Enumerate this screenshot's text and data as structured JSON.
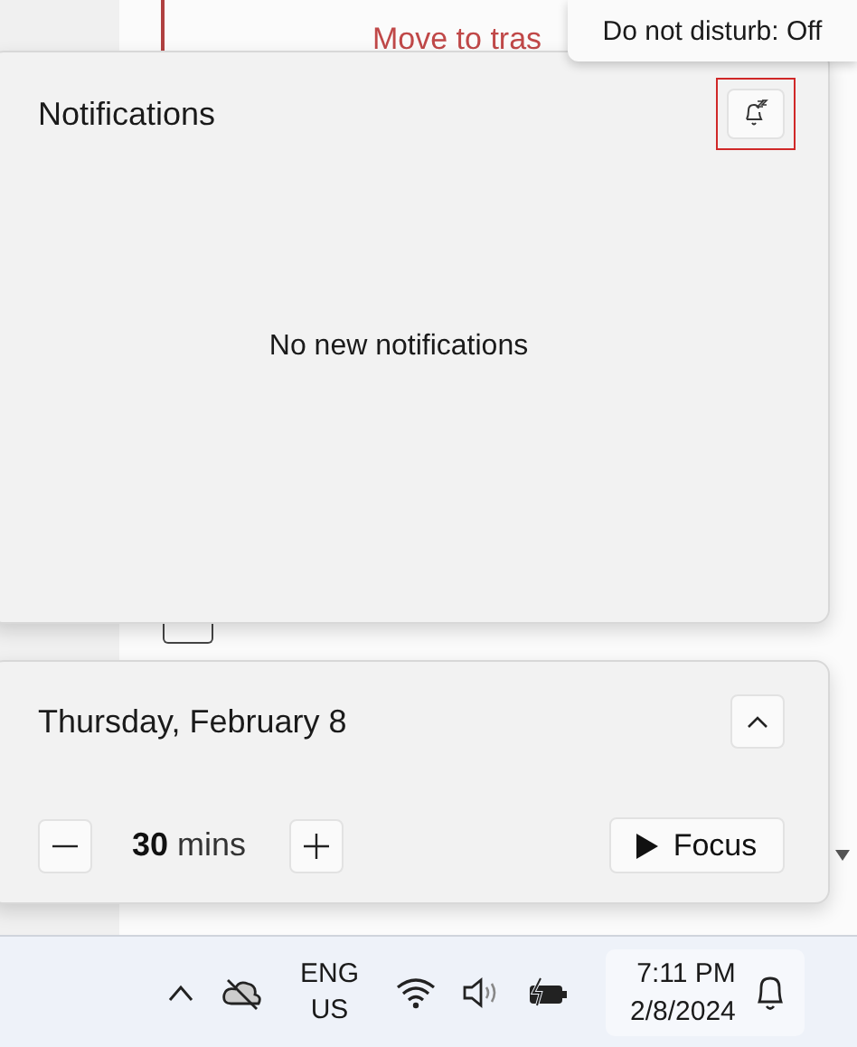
{
  "background_app": {
    "action_text": "Move to tras",
    "checkbox_checked": false
  },
  "tooltip": {
    "text": "Do not disturb: Off"
  },
  "notifications": {
    "title": "Notifications",
    "dnd_highlighted": true,
    "empty_text": "No new notifications"
  },
  "calendar": {
    "date": "Thursday, February 8",
    "expanded": true
  },
  "focus": {
    "minutes": "30",
    "unit": "mins",
    "button": "Focus"
  },
  "taskbar": {
    "language": "ENG",
    "region": "US",
    "time": "7:11 PM",
    "date": "2/8/2024"
  }
}
